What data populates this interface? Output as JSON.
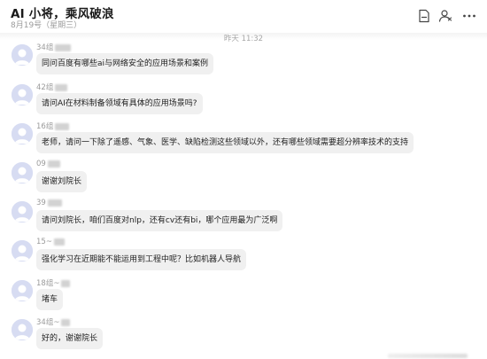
{
  "header": {
    "title": "AI 小将，乘风破浪",
    "subtitle": "8月19号（星期三）",
    "icons": [
      "document-icon",
      "members-icon",
      "more-icon"
    ]
  },
  "chat": {
    "timestamp": "昨天 11:32",
    "messages": [
      {
        "sender": "34组",
        "text": "同问百度有哪些ai与网络安全的应用场景和案例"
      },
      {
        "sender": "42组",
        "text": "请问AI在材料制备领域有具体的应用场景吗?"
      },
      {
        "sender": "16组",
        "text": "老师，请问一下除了遥感、气象、医学、缺陷检测这些领域以外，还有哪些领域需要超分辨率技术的支持"
      },
      {
        "sender": "09",
        "text": "谢谢刘院长"
      },
      {
        "sender": "39",
        "text": "请问刘院长，咱们百度对nlp，还有cv还有bi，哪个应用最为广泛啊"
      },
      {
        "sender": "15~",
        "text": "强化学习在近期能不能运用到工程中呢？比如机器人导航"
      },
      {
        "sender": "18组~",
        "text": "堵车"
      },
      {
        "sender": "34组~",
        "text": "好的，谢谢院长"
      }
    ]
  }
}
